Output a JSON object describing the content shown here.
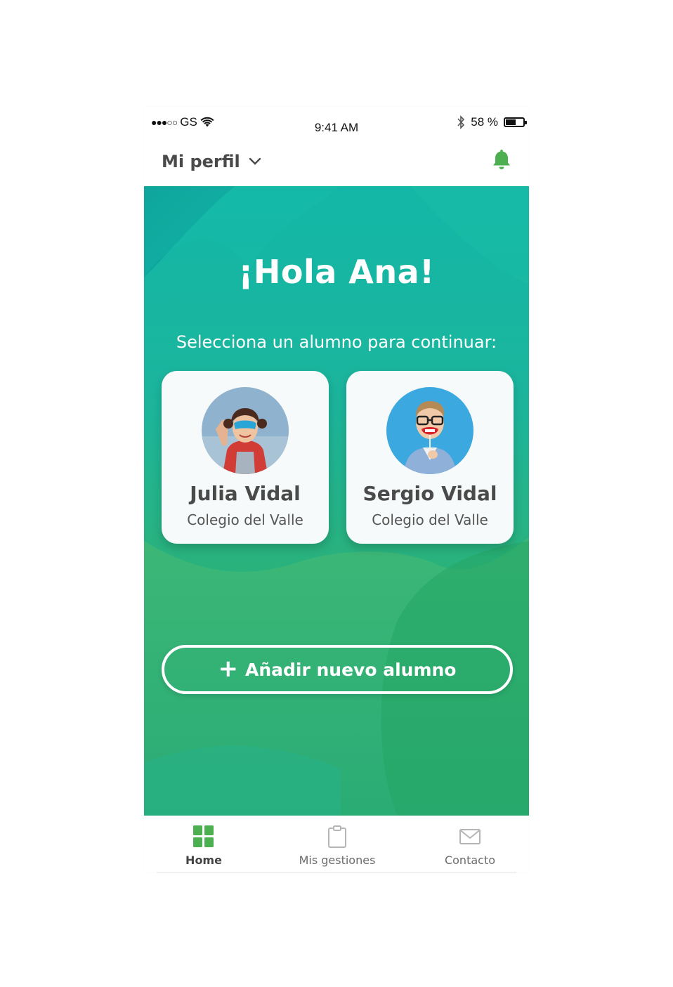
{
  "status_bar": {
    "signal": "●●●○○",
    "carrier": "GS",
    "time": "9:41 AM",
    "battery_percent": "58 %",
    "battery_level": 0.58
  },
  "header": {
    "profile_label": "Mi perfil",
    "icons": {
      "dropdown": "chevron-down-icon",
      "notifications": "bell-icon"
    }
  },
  "hero": {
    "greeting": "¡Hola Ana!",
    "prompt": "Selecciona un alumno para continuar:",
    "students": [
      {
        "name": "Julia Vidal",
        "school": "Colegio del Valle"
      },
      {
        "name": "Sergio Vidal",
        "school": "Colegio del Valle"
      }
    ],
    "add_button": {
      "icon": "+",
      "label": "Añadir nuevo alumno"
    }
  },
  "tab_bar": {
    "tabs": [
      {
        "label": "Home",
        "icon": "grid-icon",
        "active": true
      },
      {
        "label": "Mis gestiones",
        "icon": "clipboard-icon",
        "active": false
      },
      {
        "label": "Contacto",
        "icon": "mail-icon",
        "active": false
      }
    ]
  },
  "colors": {
    "accent_green": "#4caf50",
    "hero_teal": "#13b7a7",
    "hero_green": "#2bb07b"
  }
}
